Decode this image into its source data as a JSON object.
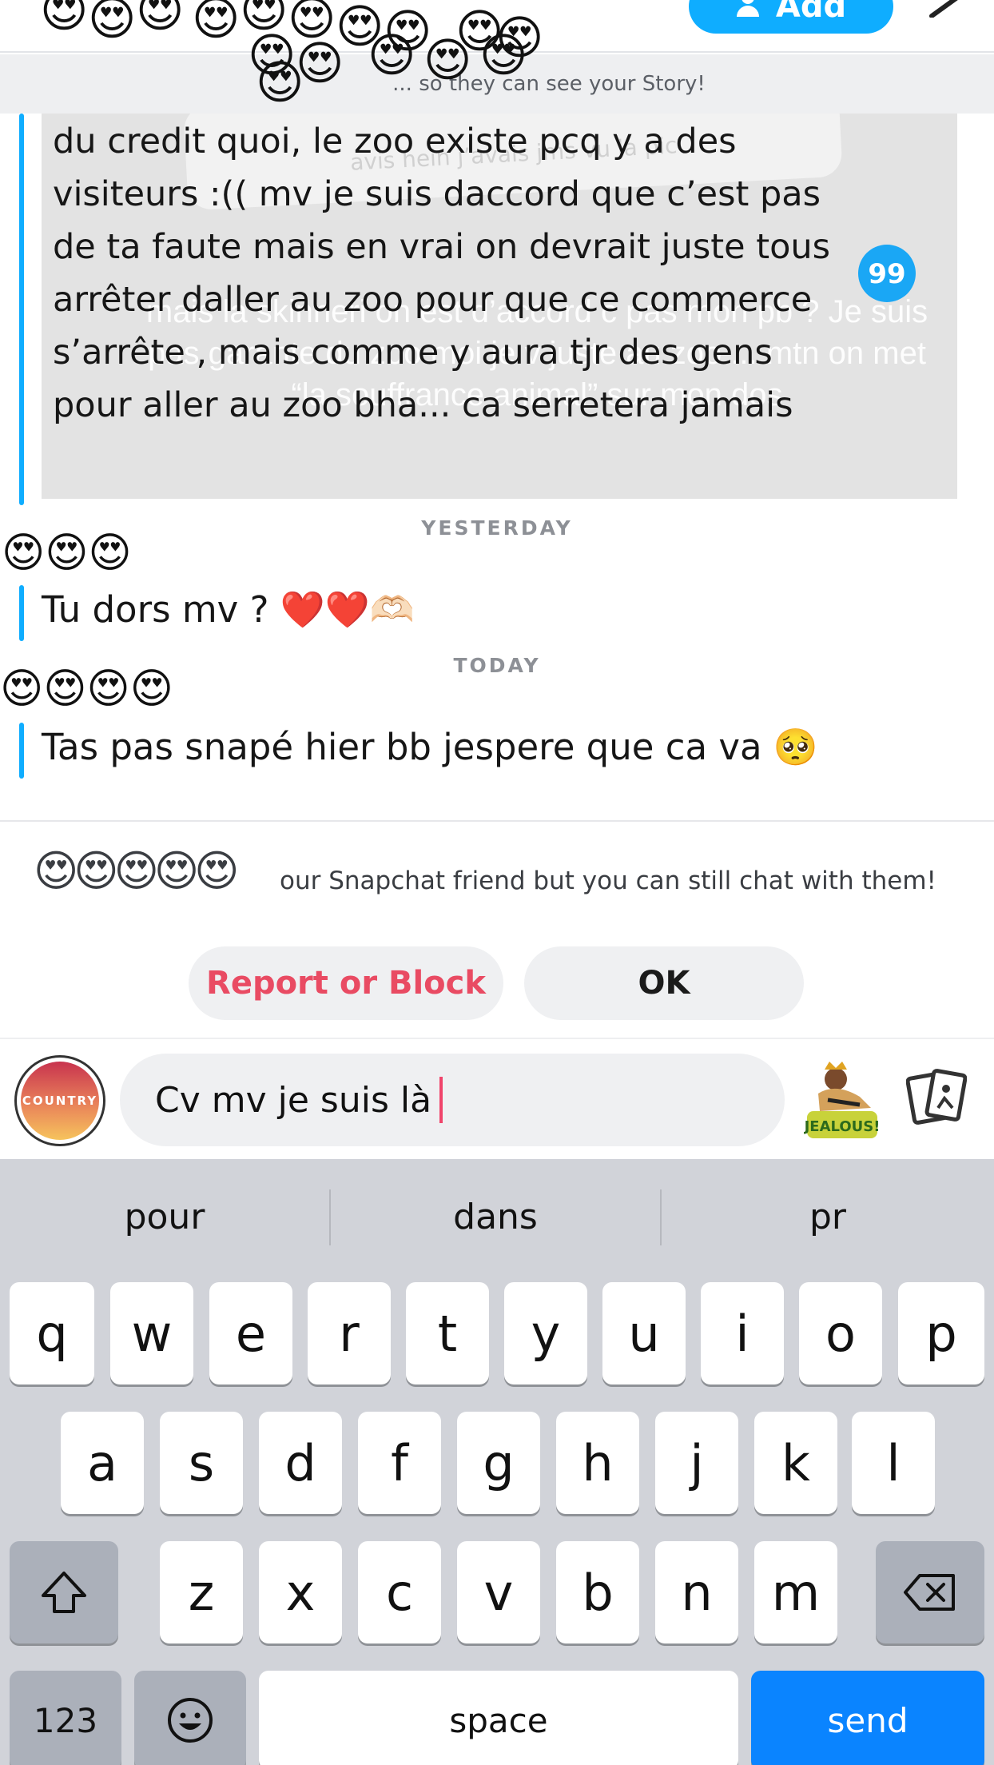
{
  "header": {
    "add_label": "Add",
    "story_banner": "... so they can see your Story!"
  },
  "chat": {
    "quoted_snap": {
      "message": "du credit quoi, le zoo existe pcq y a des visiteurs :(( mv je suis daccord que c’est pas de ta faute mais en vrai on devrait juste tous arrêter daller au zoo pour que ce commerce s’arrête , mais comme y aura tjr des gens pour aller au zoo bha... ca serretera jamais",
      "snap_caption_top": "avis hein j’avais jms vu la pic",
      "snap_caption": "mais la skinneri on est d’accord c pas mon pb ? Je suis pas garante du zoo moi je v juste au zoo ... mtn on met “la souffrance animal” sur mon dos",
      "quote_icon": "99"
    },
    "yesterday_label": "YESTERDAY",
    "today_label": "TODAY",
    "sender_emojis": "😍😍😍",
    "sender_emojis_2": "😍😍😍😍",
    "message_1": "Tu dors mv ? ❤️❤️🫶🏻",
    "message_2": "Tas pas snapé hier bb jespere que ca va 🥺",
    "notice_emojis": "😍😍😍😍😍",
    "notice_text": "our Snapchat friend but you can still chat with them!",
    "report_label": "Report or Block",
    "ok_label": "OK"
  },
  "composer": {
    "avatar_text": "COUNTRY",
    "input_value": "Cv mv je suis là",
    "bitmoji_label": "JEALOUS!"
  },
  "keyboard": {
    "suggestions": [
      "pour",
      "dans",
      "pr"
    ],
    "row1": [
      "q",
      "w",
      "e",
      "r",
      "t",
      "y",
      "u",
      "i",
      "o",
      "p"
    ],
    "row2": [
      "a",
      "s",
      "d",
      "f",
      "g",
      "h",
      "j",
      "k",
      "l"
    ],
    "row3": [
      "z",
      "x",
      "c",
      "v",
      "b",
      "n",
      "m"
    ],
    "numbers_label": "123",
    "space_label": "space",
    "send_label": "send"
  },
  "colors": {
    "accent_blue": "#0fadff",
    "report_red": "#e94b63",
    "send_blue": "#0a84ff"
  },
  "icons": [
    "person-add-icon",
    "edit-icon",
    "quote-icon",
    "sticker-icon",
    "shift-icon",
    "backspace-icon",
    "emoji-icon"
  ]
}
